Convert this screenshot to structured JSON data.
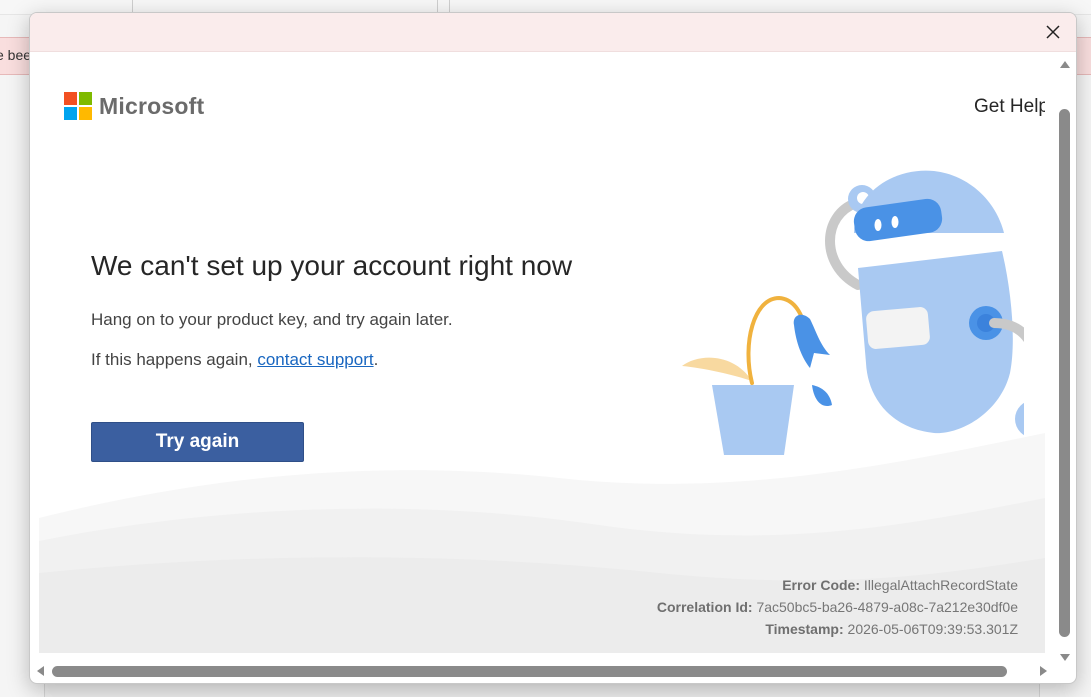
{
  "background": {
    "notice_text": "e bee"
  },
  "dialog": {
    "close_icon": "close-icon"
  },
  "header": {
    "brand": "Microsoft",
    "logo_colors": [
      "#f25022",
      "#7fba00",
      "#00a4ef",
      "#ffb900"
    ],
    "get_help": "Get Help"
  },
  "main": {
    "headline": "We can't set up your account right now",
    "line1": "Hang on to your product key, and try again later.",
    "line2_prefix": "If this happens again, ",
    "line2_link": "contact support",
    "line2_suffix": ".",
    "try_again_label": "Try again",
    "accent_color": "#3b5fa0",
    "link_color": "#1866c0"
  },
  "error": {
    "code_label": "Error Code:",
    "code_value": "IllegalAttachRecordState",
    "correlation_label": "Correlation Id:",
    "correlation_value": "7ac50bc5-ba26-4879-a08c-7a212e30df0e",
    "timestamp_label": "Timestamp:",
    "timestamp_value": "2026-05-06T09:39:53.301Z"
  },
  "illustration": {
    "icon": "robot-watering-plant-illustration"
  }
}
